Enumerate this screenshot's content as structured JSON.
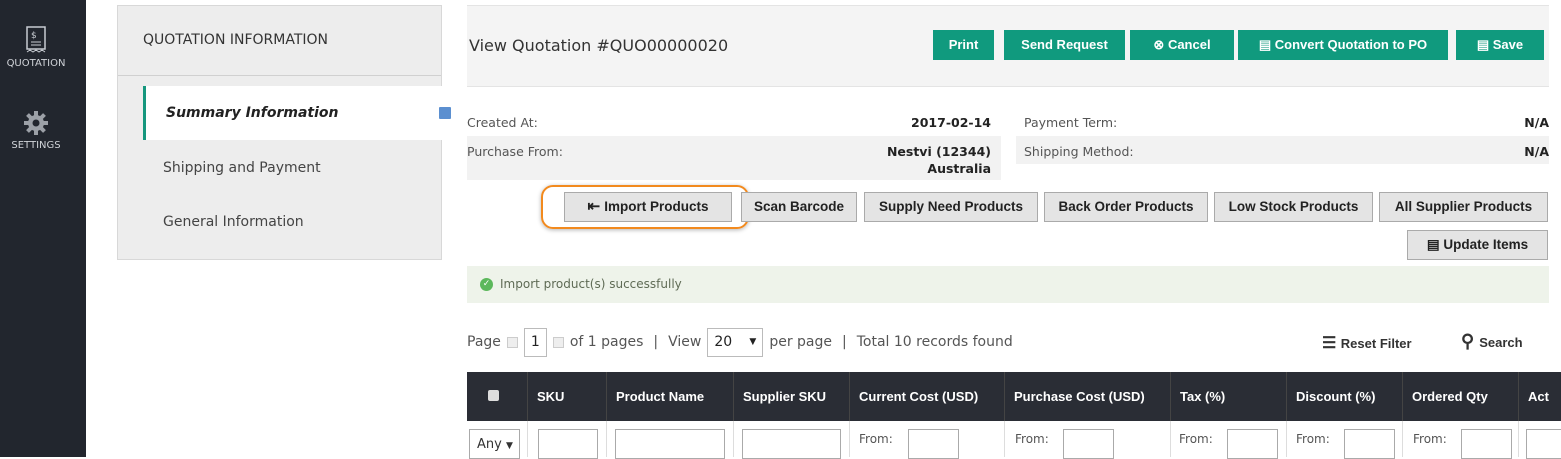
{
  "sidebar": {
    "items": [
      {
        "label": "QUOTATION",
        "icon": "receipt-icon"
      },
      {
        "label": "SETTINGS",
        "icon": "gear-icon"
      }
    ]
  },
  "left_panel": {
    "title": "QUOTATION INFORMATION",
    "items": [
      {
        "label": "Summary Information",
        "active": true
      },
      {
        "label": "Shipping and Payment"
      },
      {
        "label": "General Information"
      }
    ]
  },
  "header": {
    "title": "View Quotation #QUO00000020",
    "buttons": {
      "print": "Print",
      "send_request": "Send Request",
      "cancel": "Cancel",
      "convert": "Convert Quotation to PO",
      "save": "Save"
    }
  },
  "info": {
    "created_at_label": "Created At:",
    "created_at": "2017-02-14",
    "purchase_from_label": "Purchase From:",
    "purchase_from": "Nestvi (12344)",
    "purchase_from_country": "Australia",
    "payment_term_label": "Payment Term:",
    "payment_term": "N/A",
    "shipping_method_label": "Shipping Method:",
    "shipping_method": "N/A"
  },
  "actions": {
    "import": "Import Products",
    "scan": "Scan Barcode",
    "supply": "Supply Need Products",
    "back_order": "Back Order Products",
    "low_stock": "Low Stock Products",
    "all_supplier": "All Supplier Products",
    "update": "Update Items"
  },
  "message": "Import product(s) successfully",
  "pager": {
    "page_label": "Page",
    "page": "1",
    "of_pages": "of 1 pages",
    "sep1": "|",
    "view_label": "View",
    "per_page": "20",
    "per_page_label": "per page",
    "sep2": "|",
    "total": "Total 10 records found",
    "reset_filter": "Reset Filter",
    "search": "Search"
  },
  "table": {
    "columns": [
      "SKU",
      "Product Name",
      "Supplier SKU",
      "Current Cost (USD)",
      "Purchase Cost (USD)",
      "Tax (%)",
      "Discount (%)",
      "Ordered Qty",
      "Act"
    ],
    "filter_any": "Any",
    "from_label": "From:"
  },
  "colors": {
    "accent": "#109a7e",
    "highlight": "#f28a1e",
    "sidebar": "#22262e"
  }
}
